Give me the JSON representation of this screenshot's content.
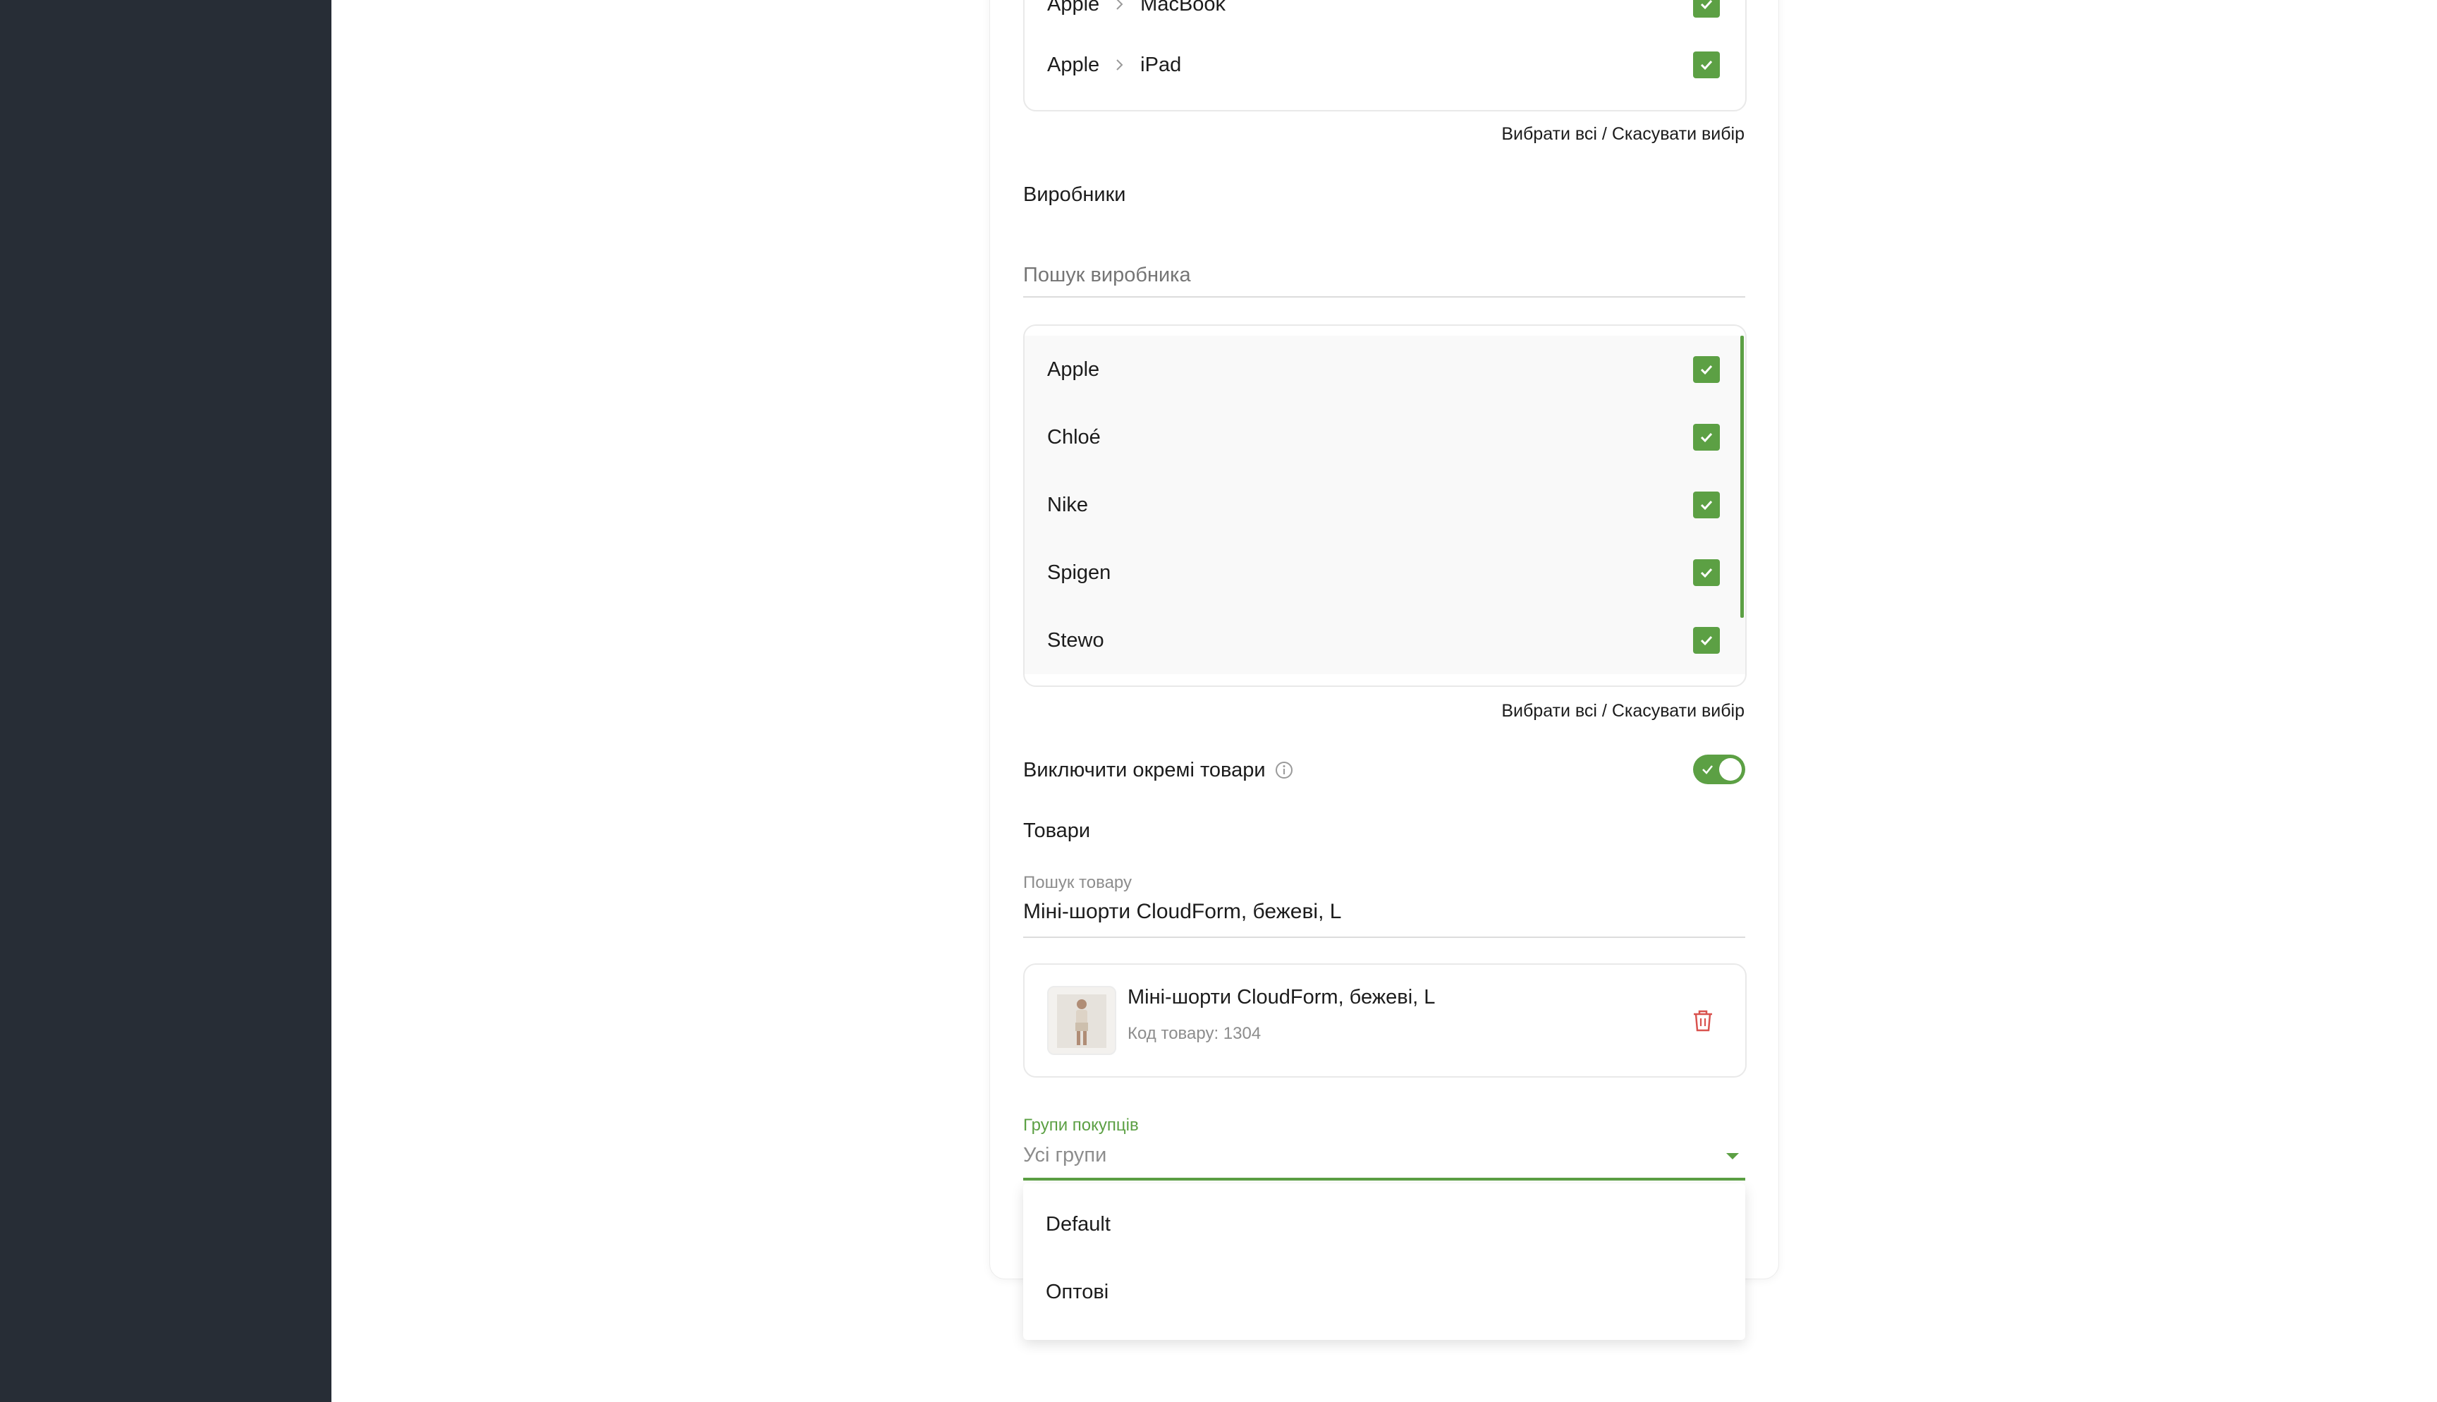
{
  "categories": {
    "rows": [
      {
        "parent": "Apple",
        "child": "MacBook"
      },
      {
        "parent": "Apple",
        "child": "iPad"
      }
    ],
    "select_all": "Вибрати всі / Скасувати вибір"
  },
  "manufacturers": {
    "heading": "Виробники",
    "search_placeholder": "Пошук виробника",
    "items": [
      "Apple",
      "Chloé",
      "Nike",
      "Spigen",
      "Stewo"
    ],
    "select_all": "Вибрати всі / Скасувати вибір"
  },
  "exclude": {
    "label": "Виключити окремі товари",
    "toggle_on": true
  },
  "products": {
    "heading": "Товари",
    "search_label": "Пошук товару",
    "search_value": "Міні-шорти CloudForm, бежеві, L",
    "selected": {
      "name": "Міні-шорти CloudForm, бежеві, L",
      "code": "Код товару: 1304"
    }
  },
  "customer_groups": {
    "label": "Групи покупців",
    "value": "Усі групи",
    "options": [
      "Default",
      "Оптові"
    ]
  },
  "colors": {
    "accent": "#5ca044",
    "sidebar": "#272d36",
    "danger": "#d9534f"
  }
}
